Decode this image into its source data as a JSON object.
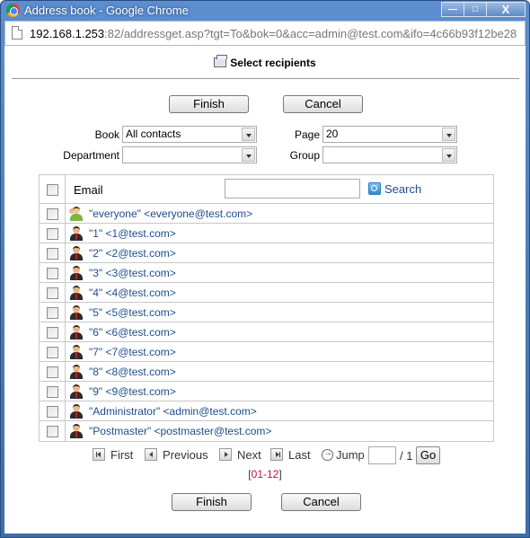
{
  "window": {
    "title": "Address book - Google Chrome",
    "controls": {
      "minimize": "—",
      "maximize": "□",
      "close": "X"
    }
  },
  "addressbar": {
    "host": "192.168.1.253",
    "path": ":82/addressget.asp?tgt=To&bok=0&acc=admin@test.com&ifo=4c66b93f12be28"
  },
  "page": {
    "heading": "Select recipients",
    "finish_label": "Finish",
    "cancel_label": "Cancel"
  },
  "filters": {
    "book_label": "Book",
    "book_value": "All contacts",
    "department_label": "Department",
    "department_value": "",
    "page_label": "Page",
    "page_value": "20",
    "group_label": "Group",
    "group_value": ""
  },
  "table": {
    "email_header": "Email",
    "search_placeholder": "",
    "search_label": "Search",
    "rows": [
      {
        "type": "group",
        "text": "\"everyone\" <everyone@test.com>"
      },
      {
        "type": "user",
        "text": "\"1\" <1@test.com>"
      },
      {
        "type": "user",
        "text": "\"2\" <2@test.com>"
      },
      {
        "type": "user",
        "text": "\"3\" <3@test.com>"
      },
      {
        "type": "user",
        "text": "\"4\" <4@test.com>"
      },
      {
        "type": "user",
        "text": "\"5\" <5@test.com>"
      },
      {
        "type": "user",
        "text": "\"6\" <6@test.com>"
      },
      {
        "type": "user",
        "text": "\"7\" <7@test.com>"
      },
      {
        "type": "user",
        "text": "\"8\" <8@test.com>"
      },
      {
        "type": "user",
        "text": "\"9\" <9@test.com>"
      },
      {
        "type": "user",
        "text": "\"Administrator\" <admin@test.com>"
      },
      {
        "type": "user",
        "text": "\"Postmaster\" <postmaster@test.com>"
      }
    ]
  },
  "pager": {
    "first": "First",
    "previous": "Previous",
    "next": "Next",
    "last": "Last",
    "jump": "Jump",
    "jump_value": "",
    "total_pages": "/ 1",
    "go": "Go",
    "range_open": "[",
    "range": "01-12",
    "range_close": "]"
  }
}
